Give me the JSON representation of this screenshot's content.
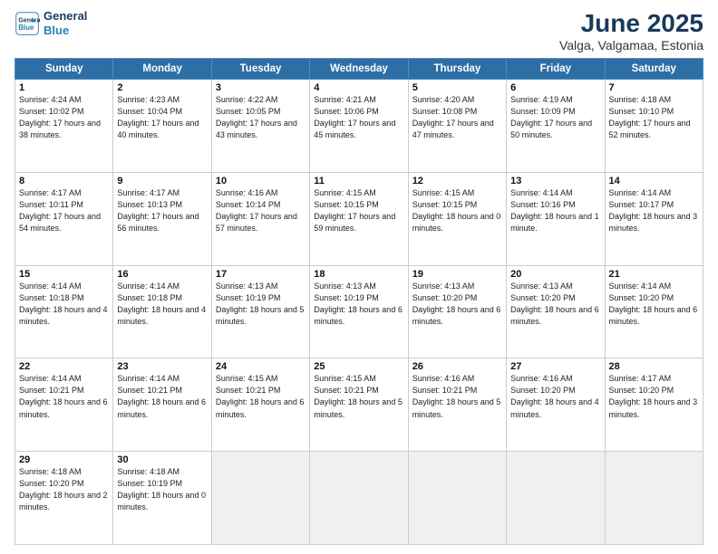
{
  "header": {
    "logo_line1": "General",
    "logo_line2": "Blue",
    "title": "June 2025",
    "subtitle": "Valga, Valgamaa, Estonia"
  },
  "weekdays": [
    "Sunday",
    "Monday",
    "Tuesday",
    "Wednesday",
    "Thursday",
    "Friday",
    "Saturday"
  ],
  "days": [
    {
      "date": "1",
      "sunrise": "4:24 AM",
      "sunset": "10:02 PM",
      "daylight": "17 hours and 38 minutes."
    },
    {
      "date": "2",
      "sunrise": "4:23 AM",
      "sunset": "10:04 PM",
      "daylight": "17 hours and 40 minutes."
    },
    {
      "date": "3",
      "sunrise": "4:22 AM",
      "sunset": "10:05 PM",
      "daylight": "17 hours and 43 minutes."
    },
    {
      "date": "4",
      "sunrise": "4:21 AM",
      "sunset": "10:06 PM",
      "daylight": "17 hours and 45 minutes."
    },
    {
      "date": "5",
      "sunrise": "4:20 AM",
      "sunset": "10:08 PM",
      "daylight": "17 hours and 47 minutes."
    },
    {
      "date": "6",
      "sunrise": "4:19 AM",
      "sunset": "10:09 PM",
      "daylight": "17 hours and 50 minutes."
    },
    {
      "date": "7",
      "sunrise": "4:18 AM",
      "sunset": "10:10 PM",
      "daylight": "17 hours and 52 minutes."
    },
    {
      "date": "8",
      "sunrise": "4:17 AM",
      "sunset": "10:11 PM",
      "daylight": "17 hours and 54 minutes."
    },
    {
      "date": "9",
      "sunrise": "4:17 AM",
      "sunset": "10:13 PM",
      "daylight": "17 hours and 56 minutes."
    },
    {
      "date": "10",
      "sunrise": "4:16 AM",
      "sunset": "10:14 PM",
      "daylight": "17 hours and 57 minutes."
    },
    {
      "date": "11",
      "sunrise": "4:15 AM",
      "sunset": "10:15 PM",
      "daylight": "17 hours and 59 minutes."
    },
    {
      "date": "12",
      "sunrise": "4:15 AM",
      "sunset": "10:15 PM",
      "daylight": "18 hours and 0 minutes."
    },
    {
      "date": "13",
      "sunrise": "4:14 AM",
      "sunset": "10:16 PM",
      "daylight": "18 hours and 1 minute."
    },
    {
      "date": "14",
      "sunrise": "4:14 AM",
      "sunset": "10:17 PM",
      "daylight": "18 hours and 3 minutes."
    },
    {
      "date": "15",
      "sunrise": "4:14 AM",
      "sunset": "10:18 PM",
      "daylight": "18 hours and 4 minutes."
    },
    {
      "date": "16",
      "sunrise": "4:14 AM",
      "sunset": "10:18 PM",
      "daylight": "18 hours and 4 minutes."
    },
    {
      "date": "17",
      "sunrise": "4:13 AM",
      "sunset": "10:19 PM",
      "daylight": "18 hours and 5 minutes."
    },
    {
      "date": "18",
      "sunrise": "4:13 AM",
      "sunset": "10:19 PM",
      "daylight": "18 hours and 6 minutes."
    },
    {
      "date": "19",
      "sunrise": "4:13 AM",
      "sunset": "10:20 PM",
      "daylight": "18 hours and 6 minutes."
    },
    {
      "date": "20",
      "sunrise": "4:13 AM",
      "sunset": "10:20 PM",
      "daylight": "18 hours and 6 minutes."
    },
    {
      "date": "21",
      "sunrise": "4:14 AM",
      "sunset": "10:20 PM",
      "daylight": "18 hours and 6 minutes."
    },
    {
      "date": "22",
      "sunrise": "4:14 AM",
      "sunset": "10:21 PM",
      "daylight": "18 hours and 6 minutes."
    },
    {
      "date": "23",
      "sunrise": "4:14 AM",
      "sunset": "10:21 PM",
      "daylight": "18 hours and 6 minutes."
    },
    {
      "date": "24",
      "sunrise": "4:15 AM",
      "sunset": "10:21 PM",
      "daylight": "18 hours and 6 minutes."
    },
    {
      "date": "25",
      "sunrise": "4:15 AM",
      "sunset": "10:21 PM",
      "daylight": "18 hours and 5 minutes."
    },
    {
      "date": "26",
      "sunrise": "4:16 AM",
      "sunset": "10:21 PM",
      "daylight": "18 hours and 5 minutes."
    },
    {
      "date": "27",
      "sunrise": "4:16 AM",
      "sunset": "10:20 PM",
      "daylight": "18 hours and 4 minutes."
    },
    {
      "date": "28",
      "sunrise": "4:17 AM",
      "sunset": "10:20 PM",
      "daylight": "18 hours and 3 minutes."
    },
    {
      "date": "29",
      "sunrise": "4:18 AM",
      "sunset": "10:20 PM",
      "daylight": "18 hours and 2 minutes."
    },
    {
      "date": "30",
      "sunrise": "4:18 AM",
      "sunset": "10:19 PM",
      "daylight": "18 hours and 0 minutes."
    }
  ]
}
